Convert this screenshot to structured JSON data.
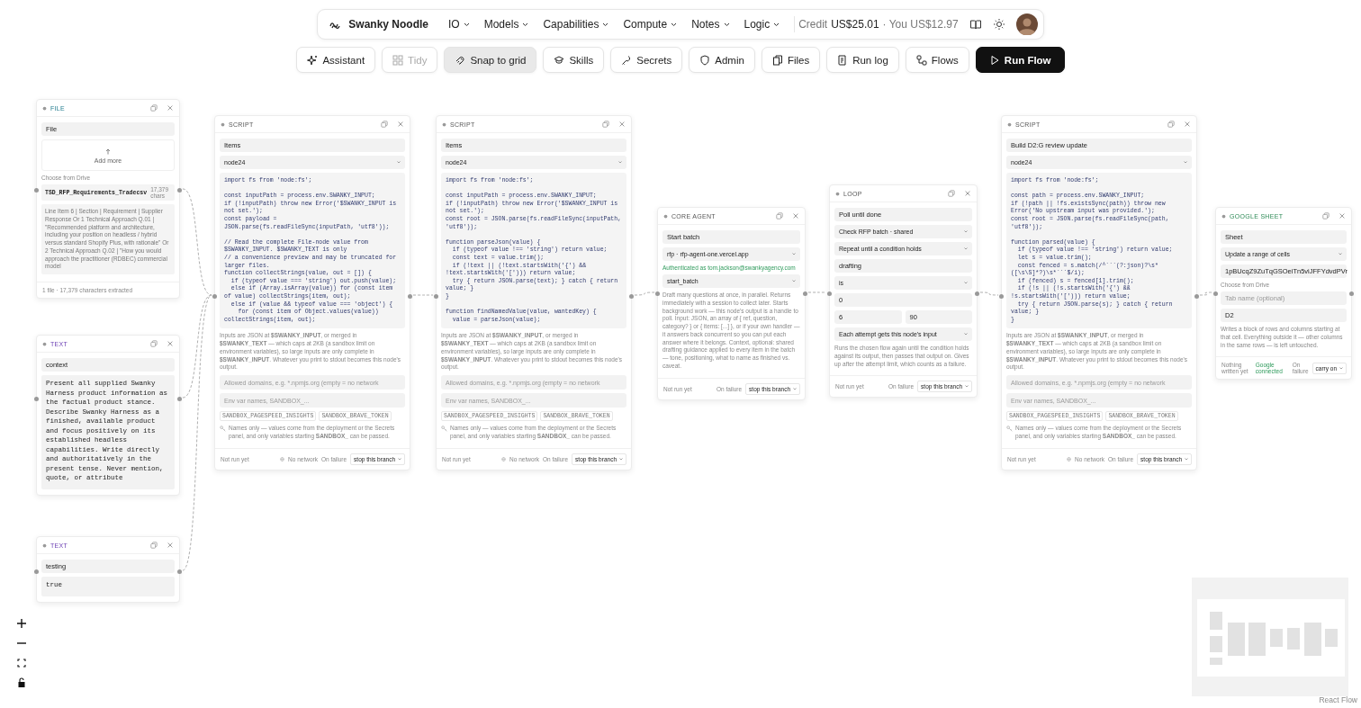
{
  "topbar": {
    "brand": "Swanky Noodle",
    "menus": [
      "IO",
      "Models",
      "Capabilities",
      "Compute",
      "Notes",
      "Logic"
    ],
    "credit_label": "Credit",
    "credit_value": "US$25.01",
    "you": "· You US$12.97"
  },
  "toolbar": [
    {
      "label": "Assistant",
      "kind": "tool",
      "selected": false,
      "disabled": false
    },
    {
      "label": "Tidy",
      "kind": "tool",
      "selected": false,
      "disabled": true
    },
    {
      "label": "Snap to grid",
      "kind": "tool",
      "selected": true,
      "disabled": false
    },
    {
      "label": "Skills",
      "kind": "tool",
      "selected": false,
      "disabled": false
    },
    {
      "label": "Secrets",
      "kind": "tool",
      "selected": false,
      "disabled": false
    },
    {
      "label": "Admin",
      "kind": "tool",
      "selected": false,
      "disabled": false
    },
    {
      "label": "Files",
      "kind": "tool",
      "selected": false,
      "disabled": false
    },
    {
      "label": "Run log",
      "kind": "tool",
      "selected": false,
      "disabled": false
    },
    {
      "label": "Flows",
      "kind": "tool",
      "selected": false,
      "disabled": false
    },
    {
      "label": "Run Flow",
      "kind": "primary",
      "selected": false,
      "disabled": false
    }
  ],
  "nodes": [
    {
      "kind": "file",
      "type_label": "FILE",
      "name": "File",
      "upload": "Add more",
      "drive_link": "Choose from Drive",
      "file_name": "TSD_RFP_Requirements_Tradecsv",
      "file_size": "17,379 chars",
      "preview": "Line Item 6 | Section | Requirement | Supplier Response Or 1 Technical Approach Q.01 | \"Recommended platform and architecture, including your position on headless / hybrid versus standard Shopify Plus, with rationale\" Or 2 Technical Approach Q.02 | \"How you would approach the practitioner (RDBEC) commercial model",
      "footer": "1 file · 17,379 characters extracted"
    },
    {
      "kind": "text",
      "type_label": "TEXT",
      "name": "context",
      "body": "Present all supplied Swanky Harness product information as the factual product stance. Describe Swanky Harness as a finished, available product and focus positively on its established headless capabilities. Write directly and authoritatively in the present tense. Never mention, quote, or attribute"
    },
    {
      "kind": "text",
      "type_label": "TEXT",
      "name": "testing",
      "body": "true"
    },
    {
      "kind": "script",
      "type_label": "SCRIPT",
      "name": "Items",
      "runtime": "node24",
      "code": "import fs from 'node:fs';\n\nconst inputPath = process.env.SWANKY_INPUT;\nif (!inputPath) throw new Error('$SWANKY_INPUT is not set.');\nconst payload = JSON.parse(fs.readFileSync(inputPath, 'utf8'));\n\n// Read the complete File-node value from $SWANKY_INPUT. $SWANKY_TEXT is only\n// a convenience preview and may be truncated for larger files.\nfunction collectStrings(value, out = []) {\n  if (typeof value === 'string') out.push(value);\n  else if (Array.isArray(value)) for (const item of value) collectStrings(item, out);\n  else if (value && typeof value === 'object') {\n    for (const item of Object.values(value)) collectStrings(item, out);",
      "help": "Inputs are JSON at **$SWANKY_INPUT**, or merged in **$SWANKY_TEXT** — which caps at 2KB (a sandbox limit on environment variables), so large inputs are only complete in **$SWANKY_INPUT**. Whatever you print to stdout becomes this node's output.",
      "domains_placeholder": "Allowed domains, e.g. *.npmjs.org (empty = no network",
      "env_placeholder": "Env var names, SANDBOX_...",
      "secrets": [
        "SANDBOX_PAGESPEED_INSIGHTS",
        "SANDBOX_BRAVE_TOKEN"
      ],
      "note": "Names only — values come from the deployment or the Secrets panel, and only variables starting **SANDBOX_** can be passed.",
      "status": "Not run yet",
      "network": "No network",
      "failure_label": "On failure",
      "failure_action": "stop this branch"
    },
    {
      "kind": "script",
      "type_label": "SCRIPT",
      "name": "Items",
      "runtime": "node24",
      "code": "import fs from 'node:fs';\n\nconst inputPath = process.env.SWANKY_INPUT;\nif (!inputPath) throw new Error('$SWANKY_INPUT is not set.');\nconst root = JSON.parse(fs.readFileSync(inputPath, 'utf8'));\n\nfunction parseJson(value) {\n  if (typeof value !== 'string') return value;\n  const text = value.trim();\n  if (!text || (!text.startsWith('{') && !text.startsWith('['))) return value;\n  try { return JSON.parse(text); } catch { return value; }\n}\n\nfunction findNamedValue(value, wantedKey) {\n  value = parseJson(value);",
      "help": "Inputs are JSON at **$SWANKY_INPUT**, or merged in **$SWANKY_TEXT** — which caps at 2KB (a sandbox limit on environment variables), so large inputs are only complete in **$SWANKY_INPUT**. Whatever you print to stdout becomes this node's output.",
      "domains_placeholder": "Allowed domains, e.g. *.npmjs.org (empty = no network",
      "env_placeholder": "Env var names, SANDBOX_...",
      "secrets": [
        "SANDBOX_PAGESPEED_INSIGHTS",
        "SANDBOX_BRAVE_TOKEN"
      ],
      "note": "Names only — values come from the deployment or the Secrets panel, and only variables starting **SANDBOX_** can be passed.",
      "status": "Not run yet",
      "network": "No network",
      "failure_label": "On failure",
      "failure_action": "stop this branch"
    },
    {
      "kind": "form",
      "type_label": "CORE AGENT",
      "name": "Start batch",
      "fields": [
        {
          "kind": "select",
          "value": "rfp · rfp-agent-one.vercel.app"
        },
        {
          "kind": "auth",
          "value": "Authenticated as tom.jackson@swankyagency.com"
        },
        {
          "kind": "select",
          "value": "start_batch"
        },
        {
          "kind": "note",
          "value": "Draft many questions at once, in parallel. Returns immediately with a session to collect later. Starts background work — this node's output is a handle to poll. Input: JSON, an array of { ref, question, category? } or { items: [...] }, or if your own handler — it answers back concurrent so you can put each answer where it belongs. Context, optional: shared drafting guidance applied to every item in the batch — tone, positioning, what to name as finished vs. caveat."
        }
      ],
      "status": "Not run yet",
      "failure_label": "On failure",
      "failure_action": "stop this branch"
    },
    {
      "kind": "form",
      "type_label": "LOOP",
      "name": "Poll until done",
      "fields": [
        {
          "kind": "select",
          "value": "Check RFP batch · shared"
        },
        {
          "kind": "select",
          "value": "Repeat until a condition holds"
        },
        {
          "kind": "input",
          "value": "drafting"
        },
        {
          "kind": "select",
          "value": "is"
        },
        {
          "kind": "input",
          "value": "0"
        },
        {
          "kind": "pair",
          "values": [
            "6",
            "90"
          ]
        },
        {
          "kind": "select",
          "value": "Each attempt gets this node's input"
        },
        {
          "kind": "note",
          "value": "Runs the chosen flow again until the condition holds against its output, then passes that output on. Gives up after the attempt limit, which counts as a failure."
        }
      ],
      "status": "Not run yet",
      "failure_label": "On failure",
      "failure_action": "stop this branch"
    },
    {
      "kind": "script",
      "type_label": "SCRIPT",
      "name": "Build D2:G review update",
      "runtime": "node24",
      "code": "import fs from 'node:fs';\n\nconst path = process.env.SWANKY_INPUT;\nif (!path || !fs.existsSync(path)) throw new Error('No upstream input was provided.');\nconst root = JSON.parse(fs.readFileSync(path, 'utf8'));\n\nfunction parsed(value) {\n  if (typeof value !== 'string') return value;\n  let s = value.trim();\n  const fenced = s.match(/^```(?:json)?\\s*([\\s\\S]*?)\\s*```$/i);\n  if (fenced) s = fenced[1].trim();\n  if (!s || (!s.startsWith('{') && !s.startsWith('['))) return value;\n  try { return JSON.parse(s); } catch { return value; }\n}",
      "help": "Inputs are JSON at **$SWANKY_INPUT**, or merged in **$SWANKY_TEXT** — which caps at 2KB (a sandbox limit on environment variables), so large inputs are only complete in **$SWANKY_INPUT**. Whatever you print to stdout becomes this node's output.",
      "domains_placeholder": "Allowed domains, e.g. *.npmjs.org (empty = no network",
      "env_placeholder": "Env var names, SANDBOX_...",
      "secrets": [
        "SANDBOX_PAGESPEED_INSIGHTS",
        "SANDBOX_BRAVE_TOKEN"
      ],
      "note": "Names only — values come from the deployment or the Secrets panel, and only variables starting **SANDBOX_** can be passed.",
      "status": "Not run yet",
      "network": "No network",
      "failure_label": "On failure",
      "failure_action": "stop this branch"
    },
    {
      "kind": "form",
      "type_label": "GOOGLE SHEET",
      "name": "Sheet",
      "fields": [
        {
          "kind": "select",
          "value": "Update a range of cells"
        },
        {
          "kind": "input",
          "value": "1pBUcqZ9ZuTqGSOeiTn5viJFFYdvdPVr"
        },
        {
          "kind": "link",
          "value": "Choose from Drive"
        },
        {
          "kind": "input",
          "placeholder": "Tab name (optional)"
        },
        {
          "kind": "input",
          "value": "D2"
        },
        {
          "kind": "note",
          "value": "Writes a block of rows and columns starting at that cell. Everything outside it — other columns in the same rows — is left untouched."
        }
      ],
      "status": "Nothing written yet",
      "connection": "Google connected",
      "failure_label": "On failure",
      "failure_action": "carry on"
    }
  ],
  "attribution": "React Flow"
}
